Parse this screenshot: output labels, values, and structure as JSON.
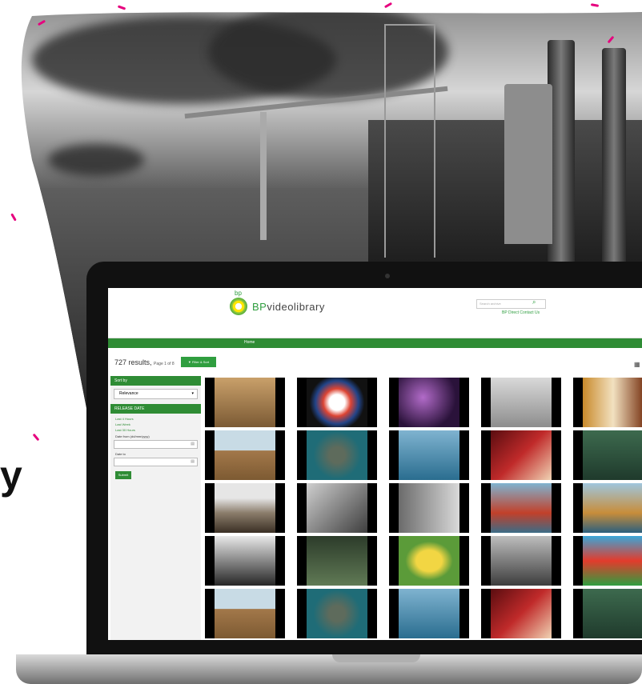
{
  "hero": {
    "colors": {
      "accent": "#e6007e"
    }
  },
  "site": {
    "logo_small": "bp",
    "logo_brand": "BP",
    "logo_rest": "videolibrary",
    "search_placeholder": "Search archive",
    "header_links": "BP Direct  Contact Us",
    "nav_home": "Home",
    "results_count": "727 results,",
    "results_page": "Page 1 of 8",
    "filter_button": "▼ Filter & Sort",
    "sidebar": {
      "sort_header": "Sort by",
      "sort_value": "Relevance",
      "release_header": "RELEASE DATE",
      "links": [
        "Last 4 Hours",
        "Last Week",
        "Last 30 Hours"
      ],
      "date_from_label": "Date from (dd/mm/yyyy)",
      "date_to_label": "Date to",
      "submit_label": "Submit"
    },
    "colors": {
      "brand_green": "#2f8c35",
      "logo_green": "#2f9e3f",
      "sun_yellow": "#ffe600"
    }
  },
  "thumbnails": [
    [
      "desert-people",
      "football-flags",
      "dancers-dark",
      "oil-rig-bw",
      "man-phone"
    ],
    [
      "offshore-diagram",
      "offshore-platform-aerial",
      "platform-sea",
      "red-pipe-closeup",
      "engineer-green"
    ],
    [
      "coastline-rocks",
      "workers-bw",
      "man-bw",
      "cranes-platform",
      "platform-module"
    ],
    [
      "arab-men-bw",
      "green-night-shot",
      "bp-logo-lawn",
      "woman-car-bw",
      "bp-sign"
    ],
    [
      "offshore-diagram",
      "offshore-platform-aerial",
      "platform-sea",
      "red-pipe-closeup",
      "engineer-green"
    ]
  ]
}
